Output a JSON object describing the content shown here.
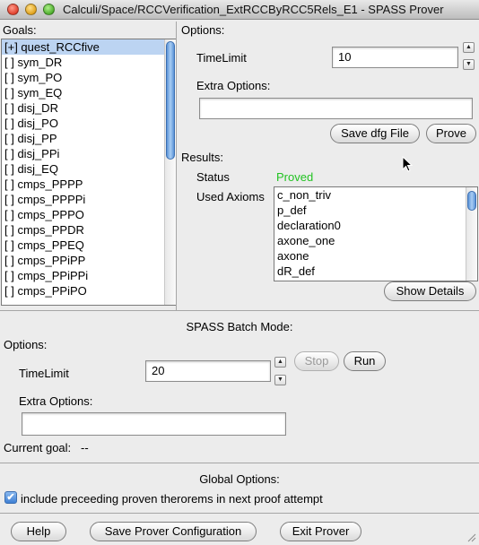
{
  "window": {
    "title": "Calculi/Space/RCCVerification_ExtRCCByRCC5Rels_E1 - SPASS Prover"
  },
  "goals": {
    "label": "Goals:",
    "items": [
      "[+] quest_RCCfive",
      "[ ] sym_DR",
      "[ ] sym_PO",
      "[ ] sym_EQ",
      "[ ] disj_DR",
      "[ ] disj_PO",
      "[ ] disj_PP",
      "[ ] disj_PPi",
      "[ ] disj_EQ",
      "[ ] cmps_PPPP",
      "[ ] cmps_PPPPi",
      "[ ] cmps_PPPO",
      "[ ] cmps_PPDR",
      "[ ] cmps_PPEQ",
      "[ ] cmps_PPiPP",
      "[ ] cmps_PPiPPi",
      "[ ] cmps_PPiPO"
    ],
    "selected_index": 0
  },
  "options": {
    "label": "Options:",
    "timelimit_label": "TimeLimit",
    "timelimit_value": "10",
    "extra_label": "Extra Options:",
    "extra_value": "",
    "save_dfg_label": "Save dfg File",
    "prove_label": "Prove"
  },
  "results": {
    "label": "Results:",
    "status_label": "Status",
    "status_value": "Proved",
    "status_color": "#22c322",
    "used_axioms_label": "Used Axioms",
    "axioms": [
      "c_non_triv",
      "p_def",
      "declaration0",
      "axone_one",
      "axone",
      "dR_def"
    ],
    "show_details_label": "Show Details"
  },
  "batch": {
    "title": "SPASS Batch Mode:",
    "options_label": "Options:",
    "timelimit_label": "TimeLimit",
    "timelimit_value": "20",
    "stop_label": "Stop",
    "run_label": "Run",
    "extra_label": "Extra Options:",
    "extra_value": "",
    "current_goal_label": "Current goal:",
    "current_goal_value": "--"
  },
  "global": {
    "title": "Global Options:",
    "include_label": "include preceeding proven therorems in next proof attempt",
    "include_checked": true
  },
  "footer": {
    "help_label": "Help",
    "save_config_label": "Save Prover Configuration",
    "exit_label": "Exit Prover"
  }
}
